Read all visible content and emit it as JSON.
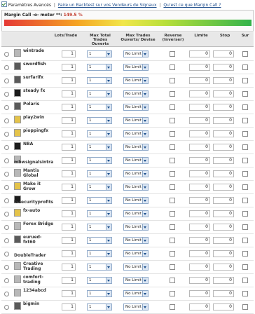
{
  "top": {
    "advanced_label": "Paramètres Avancés",
    "backtest_link": "Faire un Backtest sur vos Vendeurs de Signaux",
    "margin_link": "Qu'est ce que Margin Call ?"
  },
  "margin": {
    "label": "Margin Call -o- meter **:",
    "value": "149.5 %"
  },
  "columns": {
    "lots": "Lots/Trade",
    "max_total": "Max Total Trades Ouverts",
    "max_devise": "Max Trades Ouverts/ Devise",
    "reverse": "Reverse (Inverser)",
    "limite": "Limite",
    "stop": "Stop",
    "sur": "Sur"
  },
  "rows": [
    {
      "name": "wintrade",
      "lots": "1",
      "max_total": "1",
      "max_devise": "No Limit",
      "limite": "0",
      "stop": "0",
      "avatar": "gray"
    },
    {
      "name": "swordfish",
      "lots": "1",
      "max_total": "1",
      "max_devise": "No Limit",
      "limite": "0",
      "stop": "0",
      "avatar": "dark"
    },
    {
      "name": "surfarifx",
      "lots": "1",
      "max_total": "1",
      "max_devise": "No Limit",
      "limite": "0",
      "stop": "0",
      "avatar": "dark"
    },
    {
      "name": "steady fx",
      "lots": "1",
      "max_total": "1",
      "max_devise": "No Limit",
      "limite": "0",
      "stop": "0",
      "avatar": "black"
    },
    {
      "name": "Polaris",
      "lots": "1",
      "max_total": "1",
      "max_devise": "No Limit",
      "limite": "0",
      "stop": "0",
      "avatar": "dark"
    },
    {
      "name": "play2win",
      "lots": "1",
      "max_total": "1",
      "max_devise": "No Limit",
      "limite": "0",
      "stop": "0",
      "avatar": "yellow"
    },
    {
      "name": "pioppingfx",
      "lots": "1",
      "max_total": "1",
      "max_devise": "No Limit",
      "limite": "0",
      "stop": "0",
      "avatar": "yellow"
    },
    {
      "name": "NBA",
      "lots": "1",
      "max_total": "1",
      "max_devise": "No Limit",
      "limite": "0",
      "stop": "0",
      "avatar": "black"
    },
    {
      "name": "mbwsignalsintra",
      "lots": "1",
      "max_total": "1",
      "max_devise": "No Limit",
      "limite": "0",
      "stop": "0",
      "avatar": "gray",
      "low": true
    },
    {
      "name": "Mantis Global",
      "lots": "1",
      "max_total": "1",
      "max_devise": "No Limit",
      "limite": "0",
      "stop": "0",
      "avatar": "gray"
    },
    {
      "name": "Make it Grow",
      "lots": "1",
      "max_total": "1",
      "max_devise": "No Limit",
      "limite": "0",
      "stop": "0",
      "avatar": "yellow"
    },
    {
      "name": "fxsecurityprofits",
      "lots": "1",
      "max_total": "1",
      "max_devise": "No Limit",
      "limite": "0",
      "stop": "0",
      "avatar": "black",
      "low": true
    },
    {
      "name": "fx-auto",
      "lots": "1",
      "max_total": "1",
      "max_devise": "No Limit",
      "limite": "0",
      "stop": "0",
      "avatar": "yellow"
    },
    {
      "name": "Forex Bridge",
      "lots": "1",
      "max_total": "1",
      "max_devise": "No Limit",
      "limite": "0",
      "stop": "0",
      "avatar": "gray"
    },
    {
      "name": "eurued-fxt60",
      "lots": "1",
      "max_total": "1",
      "max_devise": "No Limit",
      "limite": "0",
      "stop": "0",
      "avatar": "dark"
    },
    {
      "name": "DoubleTrader",
      "lots": "1",
      "max_total": "1",
      "max_devise": "No Limit",
      "limite": "0",
      "stop": "0",
      "avatar": "none",
      "low": true
    },
    {
      "name": "Creative Trading",
      "lots": "1",
      "max_total": "1",
      "max_devise": "No Limit",
      "limite": "0",
      "stop": "0",
      "avatar": "gray"
    },
    {
      "name": "comfort-trading",
      "lots": "1",
      "max_total": "1",
      "max_devise": "No Limit",
      "limite": "0",
      "stop": "0",
      "avatar": "gray"
    },
    {
      "name": "1234abcd",
      "lots": "1",
      "max_total": "1",
      "max_devise": "No Limit",
      "limite": "0",
      "stop": "0",
      "avatar": "gray"
    },
    {
      "name": "bigmin",
      "lots": "1",
      "max_total": "1",
      "max_devise": "No Limit",
      "limite": "0",
      "stop": "0",
      "avatar": "dark"
    }
  ],
  "colors": {
    "header_bg": "#e8e8e8",
    "margin_value": "#c0392b",
    "link": "#1a4a8a",
    "select_border": "#8fa9c9"
  }
}
